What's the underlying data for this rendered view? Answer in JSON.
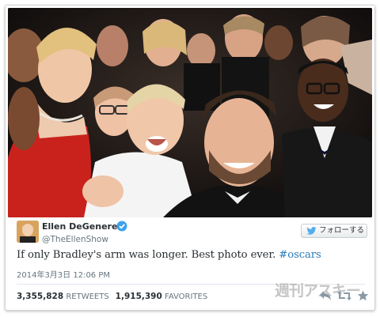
{
  "tweet": {
    "author_name": "Ellen DeGeneres",
    "author_handle": "@TheEllenShow",
    "follow_label": "フォローする",
    "text_main": "If only Bradley's arm was longer. Best photo ever. ",
    "hashtag": "#oscars",
    "date": "2014年3月3日  12:06 PM",
    "retweets_count": "3,355,828",
    "retweets_label": "RETWEETS",
    "favorites_count": "1,915,390",
    "favorites_label": "FAVORITES"
  },
  "icons": {
    "verified": "verified-badge-icon",
    "follow_bird": "twitter-bird-icon",
    "reply": "reply-icon",
    "retweet": "retweet-icon",
    "favorite": "star-icon"
  },
  "colors": {
    "link": "#2b7bb9",
    "verified": "#3ea1ec",
    "twitter_blue": "#55acee",
    "text": "#292f33",
    "muted": "#66757f"
  },
  "watermark": "週刊アスキー"
}
